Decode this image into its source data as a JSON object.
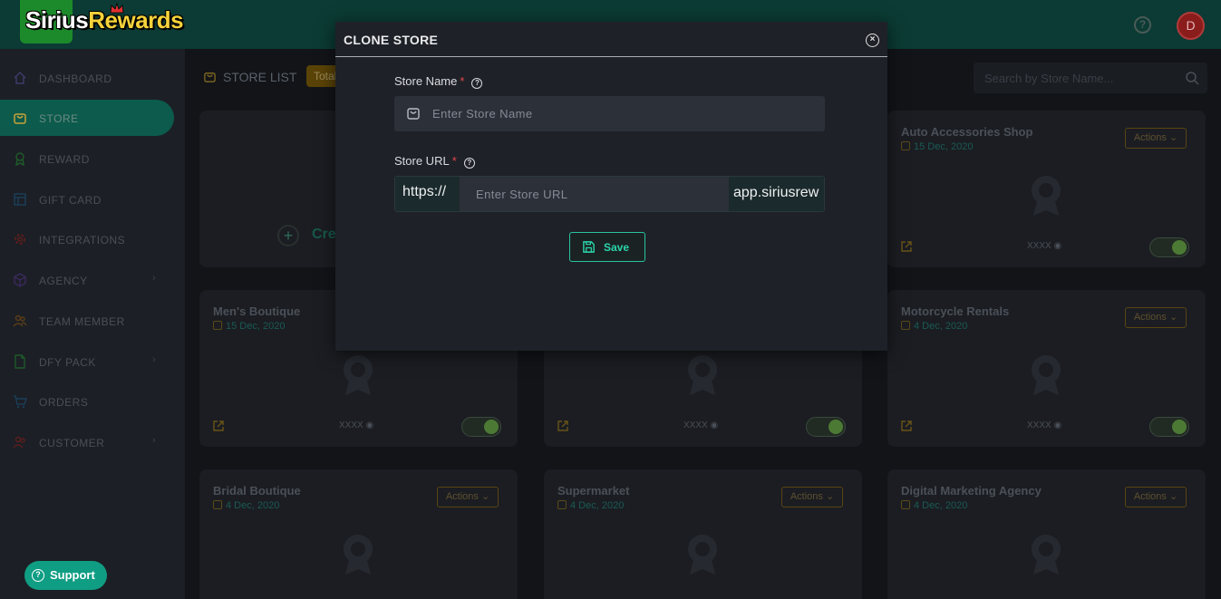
{
  "header": {
    "logo_text_1": "Sirius",
    "logo_text_2": "Rewards",
    "help_glyph": "?",
    "avatar_letter": "D"
  },
  "sidebar": {
    "items": [
      {
        "label": "DASHBOARD",
        "icon": "home-icon"
      },
      {
        "label": "STORE",
        "icon": "bag-icon",
        "active": true
      },
      {
        "label": "REWARD",
        "icon": "award-icon"
      },
      {
        "label": "GIFT CARD",
        "icon": "gift-card-icon"
      },
      {
        "label": "INTEGRATIONS",
        "icon": "gear-icon"
      },
      {
        "label": "AGENCY",
        "icon": "cube-icon",
        "has_submenu": true
      },
      {
        "label": "TEAM MEMBER",
        "icon": "users-icon"
      },
      {
        "label": "DFY PACK",
        "icon": "file-icon",
        "has_submenu": true
      },
      {
        "label": "ORDERS",
        "icon": "cart-icon"
      },
      {
        "label": "CUSTOMER",
        "icon": "customer-icon",
        "has_submenu": true
      }
    ],
    "support_label": "Support"
  },
  "main": {
    "store_list_title": "STORE LIST",
    "total_badge": "Total",
    "search_placeholder": "Search by Store Name...",
    "create_label": "Create",
    "actions_label": "Actions",
    "views_label": "XXXX",
    "cards": [
      {
        "title": "Auto Accessories Shop",
        "date": "15 Dec, 2020"
      },
      {
        "title": "Men's Boutique",
        "date": "15 Dec, 2020"
      },
      {
        "title": "",
        "date": ""
      },
      {
        "title": "Motorcycle Rentals",
        "date": "4 Dec, 2020"
      },
      {
        "title": "Bridal Boutique",
        "date": "4 Dec, 2020"
      },
      {
        "title": "Supermarket",
        "date": "4 Dec, 2020"
      },
      {
        "title": "Digital Marketing Agency",
        "date": "4 Dec, 2020"
      }
    ]
  },
  "modal": {
    "title": "CLONE STORE",
    "store_name_label": "Store Name",
    "store_name_placeholder": "Enter Store Name",
    "store_url_label": "Store URL",
    "required_mark": "*",
    "help_glyph": "?",
    "url_prefix": "https://",
    "url_placeholder": "Enter Store URL",
    "url_suffix": "app.siriusrew",
    "save_label": "Save",
    "close_glyph": "×"
  },
  "colors": {
    "header_bg": "#0b3b34",
    "accent": "#27c49f",
    "active_nav": "#0c5b4c",
    "support_btn": "#0f9d83",
    "required": "#e04848"
  }
}
